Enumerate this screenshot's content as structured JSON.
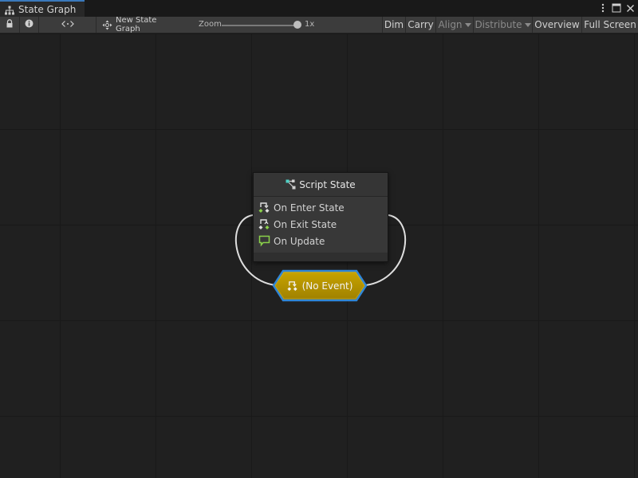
{
  "window": {
    "tab_title": "State Graph",
    "tab_icon": "hierarchy-icon"
  },
  "toolbar": {
    "lock_icon": "lock-icon",
    "info_icon": "info-icon",
    "embed_icon": "code-brackets-icon",
    "new_graph_label": "New State Graph",
    "zoom_label": "Zoom",
    "zoom_value_label": "1x",
    "dim_label": "Dim",
    "carry_label": "Carry",
    "align_label": "Align",
    "distribute_label": "Distribute",
    "overview_label": "Overview",
    "fullscreen_label": "Full Screen"
  },
  "state_node": {
    "title": "Script State",
    "events": [
      {
        "label": "On Enter State",
        "icon": "enter-state-icon"
      },
      {
        "label": "On Exit State",
        "icon": "exit-state-icon"
      },
      {
        "label": "On Update",
        "icon": "update-icon"
      }
    ]
  },
  "transition": {
    "label": "(No Event)",
    "fill_color": "#b59400",
    "outline_color": "#2f86d8"
  },
  "colors": {
    "tab_accent": "#3a79bb",
    "canvas_bg": "#202020",
    "event_icon_green": "#8ad14a"
  }
}
